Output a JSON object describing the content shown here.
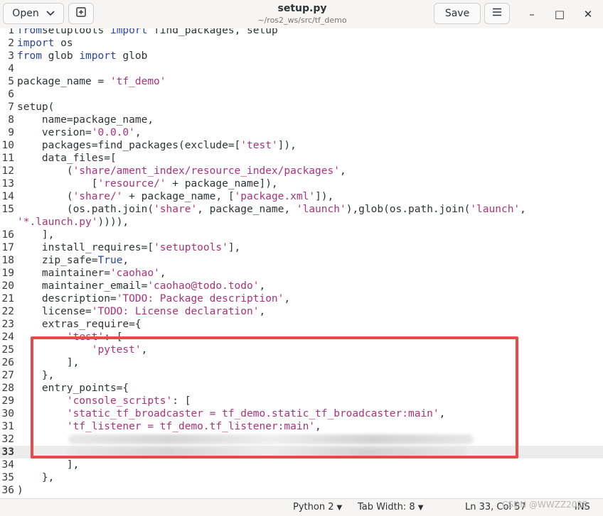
{
  "header": {
    "open_label": "Open",
    "new_tab_icon": "new-tab-icon",
    "title": "setup.py",
    "path": "~/ros2_ws/src/tf_demo",
    "save_label": "Save",
    "menu_icon": "hamburger-menu-icon",
    "minimize_glyph": "–",
    "maximize_glyph": "□",
    "close_glyph": "✕"
  },
  "editor": {
    "current_line": 33,
    "lines": [
      {
        "n": "1",
        "tokens": [
          [
            "kw",
            "from"
          ],
          [
            "",
            "setuptools"
          ],
          [
            "kw",
            " import "
          ],
          [
            "",
            "find_packages, setup"
          ]
        ]
      },
      {
        "n": "2",
        "tokens": [
          [
            "kw",
            "import"
          ],
          [
            "",
            " os"
          ]
        ]
      },
      {
        "n": "3",
        "tokens": [
          [
            "kw",
            "from"
          ],
          [
            "",
            " glob "
          ],
          [
            "kw",
            "import"
          ],
          [
            "",
            " glob"
          ]
        ]
      },
      {
        "n": "4",
        "tokens": []
      },
      {
        "n": "5",
        "tokens": [
          [
            "",
            "package_name = "
          ],
          [
            "str",
            "'tf_demo'"
          ]
        ]
      },
      {
        "n": "6",
        "tokens": []
      },
      {
        "n": "7",
        "tokens": [
          [
            "",
            "setup("
          ]
        ]
      },
      {
        "n": "8",
        "tokens": [
          [
            "",
            "    name=package_name,"
          ]
        ]
      },
      {
        "n": "9",
        "tokens": [
          [
            "",
            "    version="
          ],
          [
            "str",
            "'0.0.0'"
          ],
          [
            "",
            ","
          ]
        ]
      },
      {
        "n": "10",
        "tokens": [
          [
            "",
            "    packages=find_packages(exclude=["
          ],
          [
            "str",
            "'test'"
          ],
          [
            "",
            "]),"
          ]
        ]
      },
      {
        "n": "11",
        "tokens": [
          [
            "",
            "    data_files=["
          ]
        ]
      },
      {
        "n": "12",
        "tokens": [
          [
            "",
            "        ("
          ],
          [
            "str",
            "'share/ament_index/resource_index/packages'"
          ],
          [
            "",
            ","
          ]
        ]
      },
      {
        "n": "13",
        "tokens": [
          [
            "",
            "            ["
          ],
          [
            "str",
            "'resource/'"
          ],
          [
            "",
            " + package_name]),"
          ]
        ]
      },
      {
        "n": "14",
        "tokens": [
          [
            "",
            "        ("
          ],
          [
            "str",
            "'share/'"
          ],
          [
            "",
            " + package_name, ["
          ],
          [
            "str",
            "'package.xml'"
          ],
          [
            "",
            "]),"
          ]
        ]
      },
      {
        "n": "15",
        "tokens": [
          [
            "",
            "        (os.path.join("
          ],
          [
            "str",
            "'share'"
          ],
          [
            "",
            ", package_name, "
          ],
          [
            "str",
            "'launch'"
          ],
          [
            "",
            "),glob(os.path.join("
          ],
          [
            "str",
            "'launch'"
          ],
          [
            "",
            ","
          ]
        ]
      },
      {
        "n": "",
        "tokens": [
          [
            "str",
            "'*.launch.py'"
          ],
          [
            "",
            ")))),"
          ]
        ]
      },
      {
        "n": "16",
        "tokens": [
          [
            "",
            "    ],"
          ]
        ]
      },
      {
        "n": "17",
        "tokens": [
          [
            "",
            "    install_requires=["
          ],
          [
            "str",
            "'setuptools'"
          ],
          [
            "",
            "],"
          ]
        ]
      },
      {
        "n": "18",
        "tokens": [
          [
            "",
            "    zip_safe="
          ],
          [
            "kw",
            "True"
          ],
          [
            "",
            ","
          ]
        ]
      },
      {
        "n": "19",
        "tokens": [
          [
            "",
            "    maintainer="
          ],
          [
            "str",
            "'caohao'"
          ],
          [
            "",
            ","
          ]
        ]
      },
      {
        "n": "20",
        "tokens": [
          [
            "",
            "    maintainer_email="
          ],
          [
            "str",
            "'caohao@todo.todo'"
          ],
          [
            "",
            ","
          ]
        ]
      },
      {
        "n": "21",
        "tokens": [
          [
            "",
            "    description="
          ],
          [
            "str",
            "'TODO: Package description'"
          ],
          [
            "",
            ","
          ]
        ]
      },
      {
        "n": "22",
        "tokens": [
          [
            "",
            "    license="
          ],
          [
            "str",
            "'TODO: License declaration'"
          ],
          [
            "",
            ","
          ]
        ]
      },
      {
        "n": "23",
        "tokens": [
          [
            "",
            "    extras_require={"
          ]
        ]
      },
      {
        "n": "24",
        "tokens": [
          [
            "",
            "        "
          ],
          [
            "str",
            "'test'"
          ],
          [
            "",
            ": ["
          ]
        ]
      },
      {
        "n": "25",
        "tokens": [
          [
            "",
            "            "
          ],
          [
            "str",
            "'pytest'"
          ],
          [
            "",
            ","
          ]
        ]
      },
      {
        "n": "26",
        "tokens": [
          [
            "",
            "        ],"
          ]
        ]
      },
      {
        "n": "27",
        "tokens": [
          [
            "",
            "    },"
          ]
        ]
      },
      {
        "n": "28",
        "tokens": [
          [
            "",
            "    entry_points={"
          ]
        ]
      },
      {
        "n": "29",
        "tokens": [
          [
            "",
            "        "
          ],
          [
            "str",
            "'console_scripts'"
          ],
          [
            "",
            ": ["
          ]
        ]
      },
      {
        "n": "30",
        "tokens": [
          [
            "",
            "        "
          ],
          [
            "str",
            "'static_tf_broadcaster = tf_demo.static_tf_broadcaster:main'"
          ],
          [
            "",
            ","
          ]
        ]
      },
      {
        "n": "31",
        "tokens": [
          [
            "",
            "        "
          ],
          [
            "str",
            "'tf_listener = tf_demo.tf_listener:main'"
          ],
          [
            "",
            ","
          ]
        ]
      },
      {
        "n": "32",
        "tokens": [],
        "blurred": true
      },
      {
        "n": "33",
        "tokens": [],
        "blurred": true
      },
      {
        "n": "34",
        "tokens": [
          [
            "",
            "        ],"
          ]
        ]
      },
      {
        "n": "35",
        "tokens": [
          [
            "",
            "    },"
          ]
        ]
      },
      {
        "n": "36",
        "tokens": [
          [
            "",
            ")"
          ]
        ]
      }
    ]
  },
  "status": {
    "language": "Python 2",
    "tab_width": "Tab Width: 8",
    "position": "Ln 33, Col 57",
    "mode": "INS"
  },
  "watermark": "CSDN @WWZZ2025",
  "colors": {
    "keyword": "#2a44a6",
    "string": "#a8337a",
    "highlight_border": "#e84a4a"
  }
}
